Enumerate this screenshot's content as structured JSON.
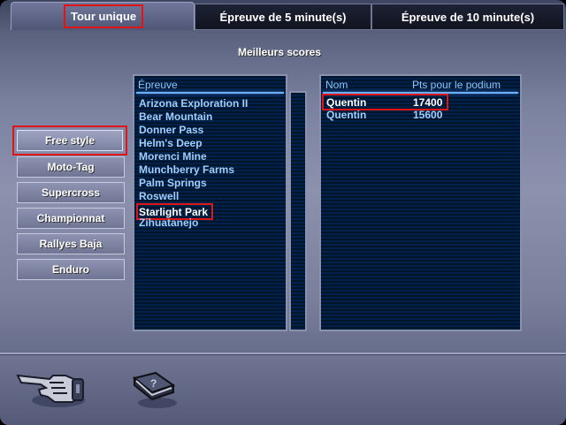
{
  "tabs": [
    {
      "label": "Tour unique",
      "active": true
    },
    {
      "label": "Épreuve de 5 minute(s)",
      "active": false
    },
    {
      "label": "Épreuve de 10 minute(s)",
      "active": false
    }
  ],
  "section_title": "Meilleurs scores",
  "modes": [
    {
      "label": "Free style",
      "selected": true
    },
    {
      "label": "Moto-Tag"
    },
    {
      "label": "Supercross"
    },
    {
      "label": "Championnat"
    },
    {
      "label": "Rallyes Baja"
    },
    {
      "label": "Enduro"
    }
  ],
  "events": {
    "header": "Épreuve",
    "items": [
      "Arizona Exploration II",
      "Bear Mountain",
      "Donner Pass",
      "Helm's Deep",
      "Morenci Mine",
      "Munchberry Farms",
      "Palm Springs",
      "Roswell",
      "Starlight Park",
      "Zihuatanejo"
    ],
    "selected_index": 8
  },
  "scores": {
    "col_name": "Nom",
    "col_points": "Pts pour le podium",
    "rows": [
      {
        "name": "Quentin",
        "points": "17400"
      },
      {
        "name": "Quentin",
        "points": "15600"
      }
    ]
  },
  "icons": {
    "back": "pointing-hand-icon",
    "help": "help-book-icon"
  },
  "colors": {
    "highlight": "#e01515",
    "list_text": "#9fcfff",
    "header_text": "#88c8ff",
    "panel_bg": "#001a38"
  }
}
